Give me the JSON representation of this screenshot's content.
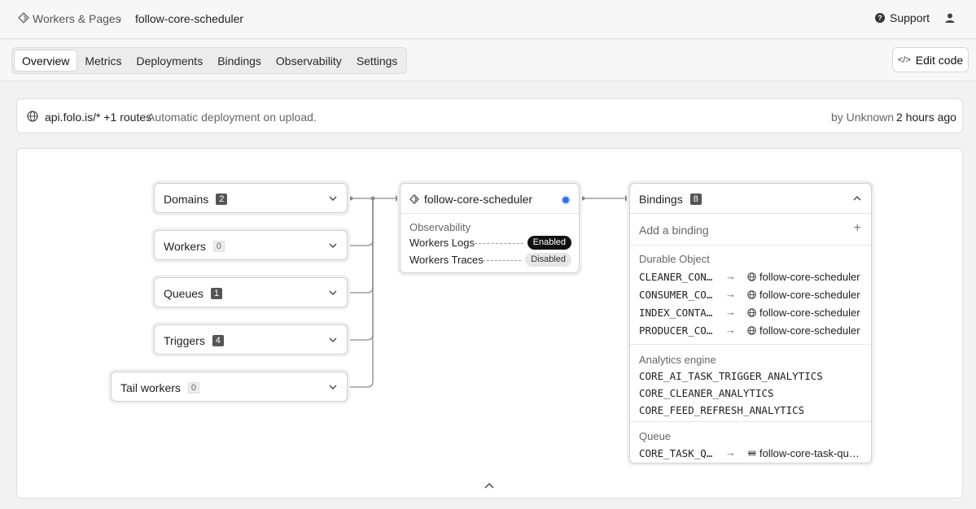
{
  "header": {
    "breadcrumb_root": "Workers & Pages",
    "breadcrumb_current": "follow-core-scheduler",
    "support_label": "Support"
  },
  "tabs": [
    {
      "label": "Overview",
      "active": true
    },
    {
      "label": "Metrics"
    },
    {
      "label": "Deployments"
    },
    {
      "label": "Bindings"
    },
    {
      "label": "Observability"
    },
    {
      "label": "Settings"
    }
  ],
  "edit_code_label": "Edit code",
  "route": {
    "url": "api.folo.is/*",
    "extra_routes": "+1 routes",
    "note": "Automatic deployment on upload.",
    "by": "by Unknown",
    "time": "2 hours ago"
  },
  "nodes": {
    "domains": {
      "label": "Domains",
      "count": "2"
    },
    "workers": {
      "label": "Workers",
      "count": "0"
    },
    "queues": {
      "label": "Queues",
      "count": "1"
    },
    "triggers": {
      "label": "Triggers",
      "count": "4"
    },
    "tail_workers": {
      "label": "Tail workers",
      "count": "0"
    }
  },
  "worker": {
    "name": "follow-core-scheduler",
    "observability_title": "Observability",
    "logs_label": "Workers Logs",
    "logs_status": "Enabled",
    "traces_label": "Workers Traces",
    "traces_status": "Disabled",
    "status_color": "#2f6fe4"
  },
  "bindings": {
    "label": "Bindings",
    "count": "8",
    "add_label": "Add a binding",
    "durable_object": {
      "title": "Durable Object",
      "items": [
        {
          "name": "CLEANER_CONTAINER",
          "target": "follow-core-scheduler"
        },
        {
          "name": "CONSUMER_CONTAINER",
          "target": "follow-core-scheduler"
        },
        {
          "name": "INDEX_CONTAINER",
          "target": "follow-core-scheduler"
        },
        {
          "name": "PRODUCER_CONTAINER",
          "target": "follow-core-scheduler"
        }
      ]
    },
    "analytics_engine": {
      "title": "Analytics engine",
      "items": [
        "CORE_AI_TASK_TRIGGER_ANALYTICS",
        "CORE_CLEANER_ANALYTICS",
        "CORE_FEED_REFRESH_ANALYTICS"
      ]
    },
    "queue": {
      "title": "Queue",
      "items": [
        {
          "name": "CORE_TASK_QUEUE",
          "target": "follow-core-task-queue"
        }
      ]
    }
  }
}
